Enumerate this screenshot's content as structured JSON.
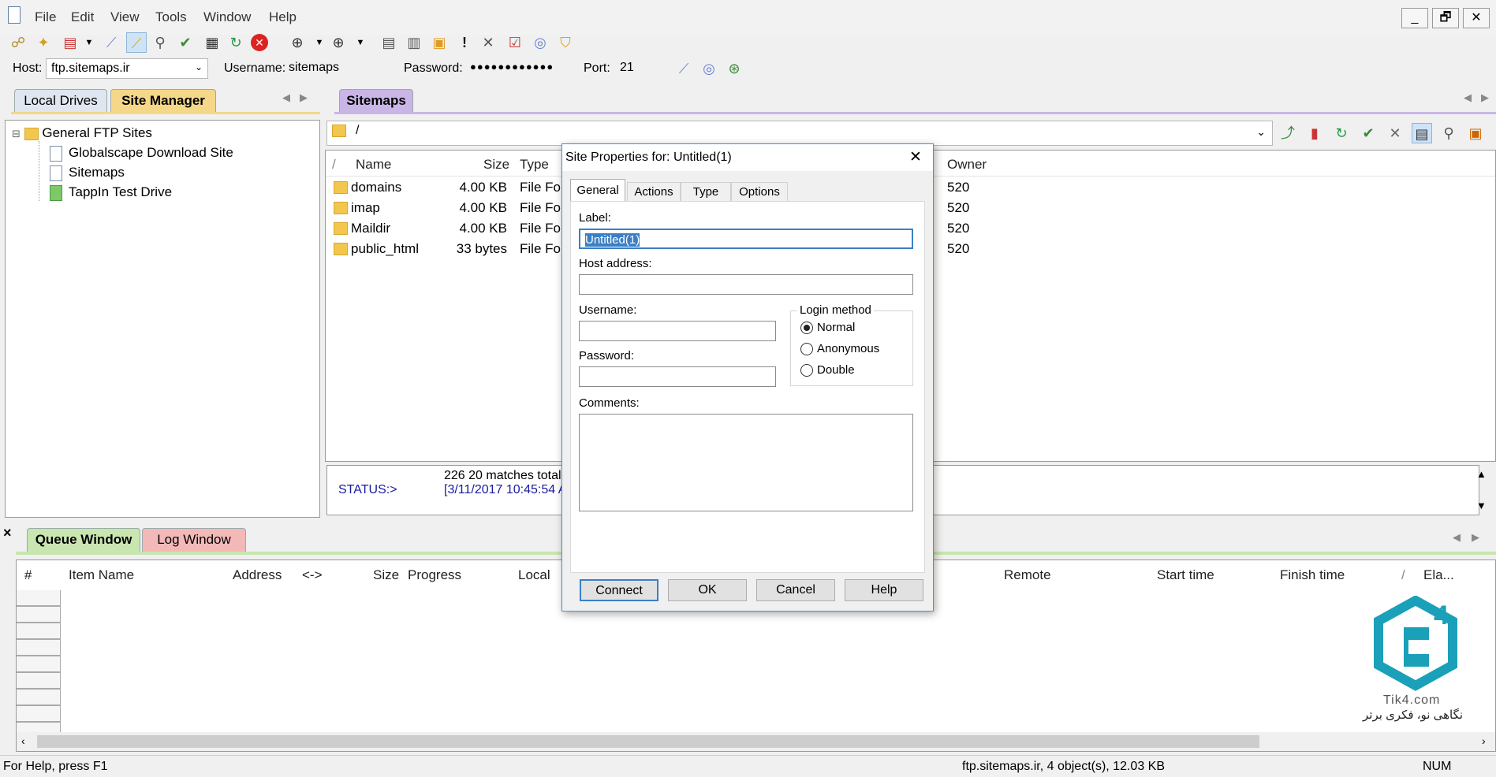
{
  "menu": {
    "items": [
      "File",
      "Edit",
      "View",
      "Tools",
      "Window",
      "Help"
    ]
  },
  "window_controls": {
    "minimize": "_",
    "restore": "🗗",
    "close": "✕"
  },
  "connection": {
    "host_label": "Host:",
    "host_value": "ftp.sitemaps.ir",
    "username_label": "Username:",
    "username_value": "sitemaps",
    "password_label": "Password:",
    "password_value": "●●●●●●●●●●●●",
    "port_label": "Port:",
    "port_value": "21"
  },
  "left_tabs": {
    "local": "Local Drives",
    "site_manager": "Site Manager"
  },
  "tree": {
    "root": "General FTP Sites",
    "expander": "⊟",
    "items": [
      "Globalscape Download Site",
      "Sitemaps",
      "TappIn Test Drive"
    ]
  },
  "remote": {
    "tab": "Sitemaps",
    "path": "/",
    "sort_indicator": "/",
    "columns": {
      "name": "Name",
      "size": "Size",
      "type": "Type",
      "owner": "Owner"
    },
    "rows": [
      {
        "name": "domains",
        "size": "4.00 KB",
        "type": "File Fol",
        "owner": "520"
      },
      {
        "name": "imap",
        "size": "4.00 KB",
        "type": "File Fol",
        "owner": "520"
      },
      {
        "name": "Maildir",
        "size": "4.00 KB",
        "type": "File Fol",
        "owner": "520"
      },
      {
        "name": "public_html",
        "size": "33 bytes",
        "type": "File Fol",
        "owner": "520"
      }
    ]
  },
  "status": {
    "label": "STATUS:>",
    "line1": "226 20 matches total",
    "line2": "[3/11/2017 10:45:54 A"
  },
  "queue": {
    "close": "×",
    "tabs": {
      "queue": "Queue Window",
      "log": "Log Window"
    },
    "columns": [
      "#",
      "Item Name",
      "Address",
      "<->",
      "Size",
      "Progress",
      "Local",
      "Remote",
      "Start time",
      "Finish time",
      "/",
      "Ela..."
    ]
  },
  "dialog": {
    "title": "Site Properties for: Untitled(1)",
    "close": "✕",
    "tabs": [
      "General",
      "Actions",
      "Type",
      "Options"
    ],
    "label_label": "Label:",
    "label_value": "Untitled(1)",
    "host_label": "Host address:",
    "username_label": "Username:",
    "password_label": "Password:",
    "login_method_label": "Login method",
    "login_options": [
      "Normal",
      "Anonymous",
      "Double"
    ],
    "login_selected": "Normal",
    "comments_label": "Comments:",
    "buttons": {
      "connect": "Connect",
      "ok": "OK",
      "cancel": "Cancel",
      "help": "Help"
    }
  },
  "watermark": {
    "site": "Tik4.com",
    "tagline": "نگاهی نو، فکری برتر"
  },
  "statusbar": {
    "help": "For Help, press F1",
    "summary": "ftp.sitemaps.ir, 4 object(s), 12.03 KB",
    "num": "NUM"
  },
  "colors": {
    "site_manager_tab": "#f5d78a",
    "sitemaps_tab": "#c9b6e6",
    "queue_tab": "#c9e6b0",
    "log_tab": "#f3b9b9",
    "status_blue": "#1a1aa0",
    "accent": "#3b7fc4"
  },
  "icons": [
    "new-document-icon",
    "connect-icon",
    "bookmark-icon",
    "disconnect-icon",
    "refresh-icon",
    "stop-icon",
    "download-icon",
    "upload-icon",
    "delete-icon",
    "watermark-logo"
  ]
}
